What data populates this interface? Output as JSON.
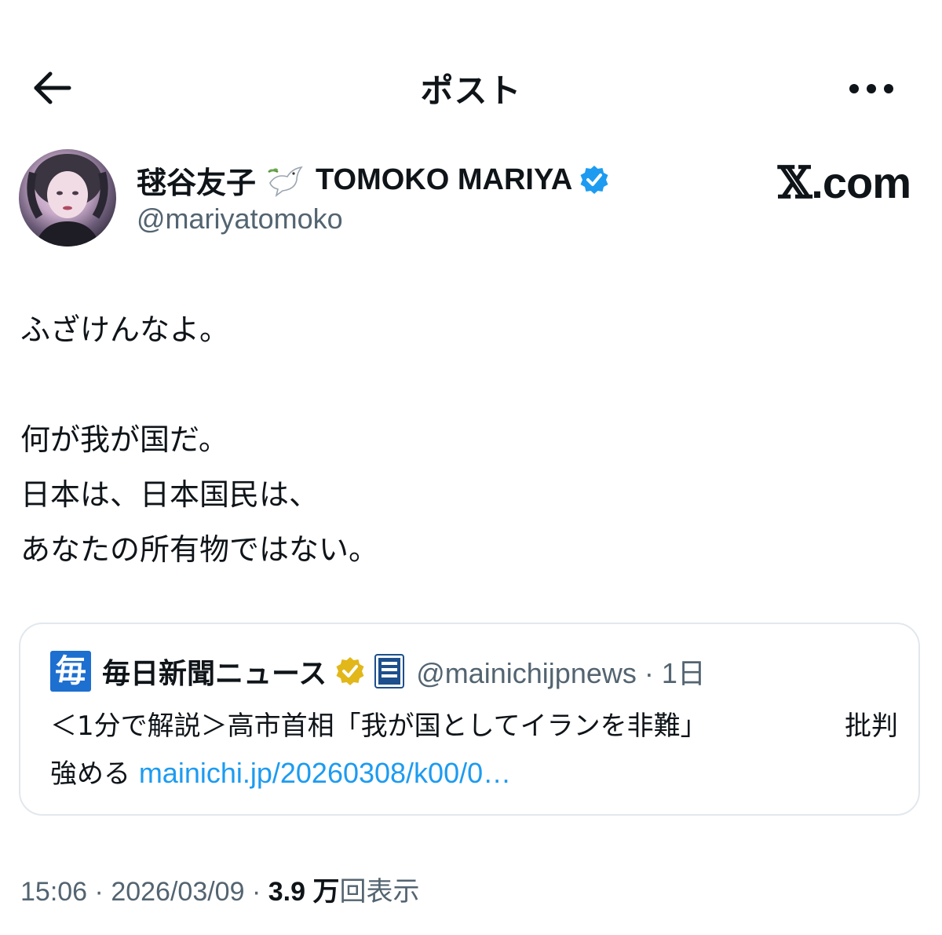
{
  "header": {
    "title": "ポスト",
    "back_icon": "arrow-left-icon",
    "more_icon": "more-horizontal-icon"
  },
  "author": {
    "display_name_jp": "毬谷友子",
    "display_name_emoji": "dove-icon",
    "display_name_en": "TOMOKO MARIYA",
    "handle": "@mariyatomoko",
    "verified": true,
    "verified_color": "#1d9bf0"
  },
  "watermark": {
    "x": "𝕏",
    "rest": ".com"
  },
  "post": {
    "text": "ふざけんなよ。\n\n何が我が国だ。\n日本は、日本国民は、\nあなたの所有物ではない。"
  },
  "quote": {
    "logo_char": "毎",
    "account_name": "毎日新聞ニュース",
    "verified_color": "#e2b719",
    "handle": "@mainichijpnews",
    "time": "1日",
    "separator": "·",
    "text_part1": "＜1分で解説＞高市首相「我が国としてイランを非難」",
    "text_part2": "批判",
    "text_part3": "強める",
    "link": "mainichi.jp/20260308/k00/0…"
  },
  "meta": {
    "time": "15:06",
    "separator": "·",
    "date": "2026/03/09",
    "views_count": "3.9 万",
    "views_label": "回表示"
  },
  "colors": {
    "text": "#0f1419",
    "secondary": "#536471",
    "link": "#1d9bf0",
    "border": "#e1e8ed"
  }
}
